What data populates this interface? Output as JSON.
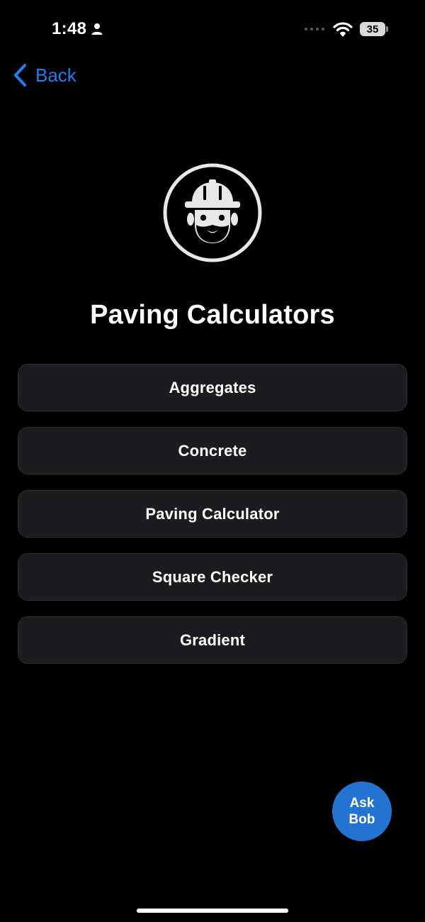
{
  "status_bar": {
    "time": "1:48",
    "battery": "35",
    "icons": {
      "person": "person-icon",
      "signal": "signal-dots-icon",
      "wifi": "wifi-icon",
      "battery": "battery-icon"
    }
  },
  "nav": {
    "back_label": "Back",
    "back_icon": "chevron-left-icon"
  },
  "header": {
    "logo_icon": "construction-worker-icon",
    "title": "Paving Calculators"
  },
  "menu": {
    "items": [
      {
        "label": "Aggregates"
      },
      {
        "label": "Concrete"
      },
      {
        "label": "Paving Calculator"
      },
      {
        "label": "Square Checker"
      },
      {
        "label": "Gradient"
      }
    ]
  },
  "assistant": {
    "line1": "Ask",
    "line2": "Bob"
  },
  "colors": {
    "background": "#000000",
    "accent": "#1f7ff0",
    "button_background": "#1c1c1e",
    "assistant_button": "#2373d2",
    "text": "#ffffff"
  }
}
